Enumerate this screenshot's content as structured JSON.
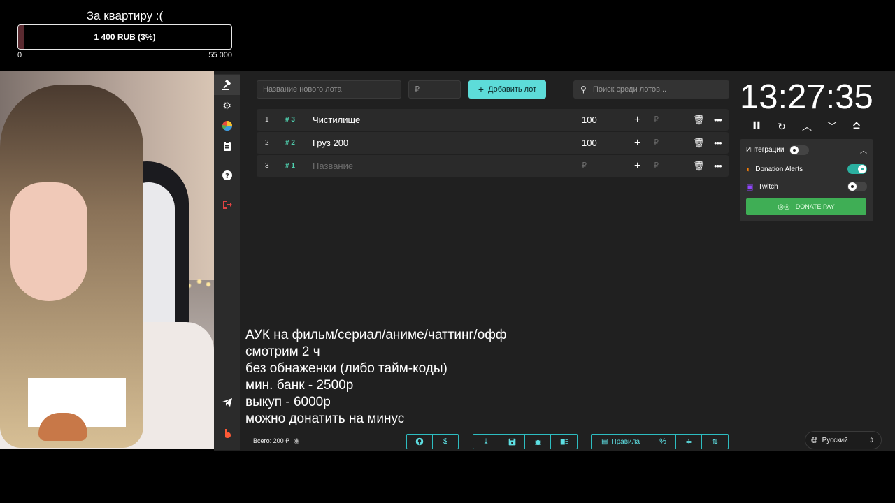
{
  "goal": {
    "title": "За квартиру :(",
    "progress_text": "1 400 RUB (3%)",
    "progress_fraction": 0.03,
    "min": "0",
    "max": "55 000"
  },
  "toolbar": {
    "new_lot_placeholder": "Название нового лота",
    "amount_placeholder": "₽",
    "add_lot_label": "Добавить лот",
    "search_placeholder": "Поиск среди лотов..."
  },
  "lots": [
    {
      "index": "1",
      "id": "3",
      "name": "Чистилище",
      "amount": "100",
      "rub": "₽"
    },
    {
      "index": "2",
      "id": "2",
      "name": "Груз 200",
      "amount": "100",
      "rub": "₽"
    },
    {
      "index": "3",
      "id": "1",
      "name": "Название",
      "amount": "₽",
      "rub": "₽"
    }
  ],
  "timer": {
    "value": "13:27:35"
  },
  "integrations": {
    "title": "Интеграции",
    "donation_alerts": "Donation Alerts",
    "twitch": "Twitch",
    "donate_pay": "DONATE PAY"
  },
  "overlay_lines": [
    "АУК на фильм/сериал/аниме/чаттинг/офф",
    "смотрим 2 ч",
    "без обнаженки (либо тайм-коды)",
    "мин. банк - 2500р",
    "выкуп - 6000р",
    "можно донатить на минус"
  ],
  "footer": {
    "total": "Всего: 200 ₽",
    "rules_label": "Правила",
    "percent_label": "%",
    "language": "Русский"
  },
  "colors": {
    "accent": "#5ddcd9",
    "id_green": "#4fd1b0",
    "donate_pay": "#3fae55",
    "toggle_on": "#2bb0a0"
  }
}
